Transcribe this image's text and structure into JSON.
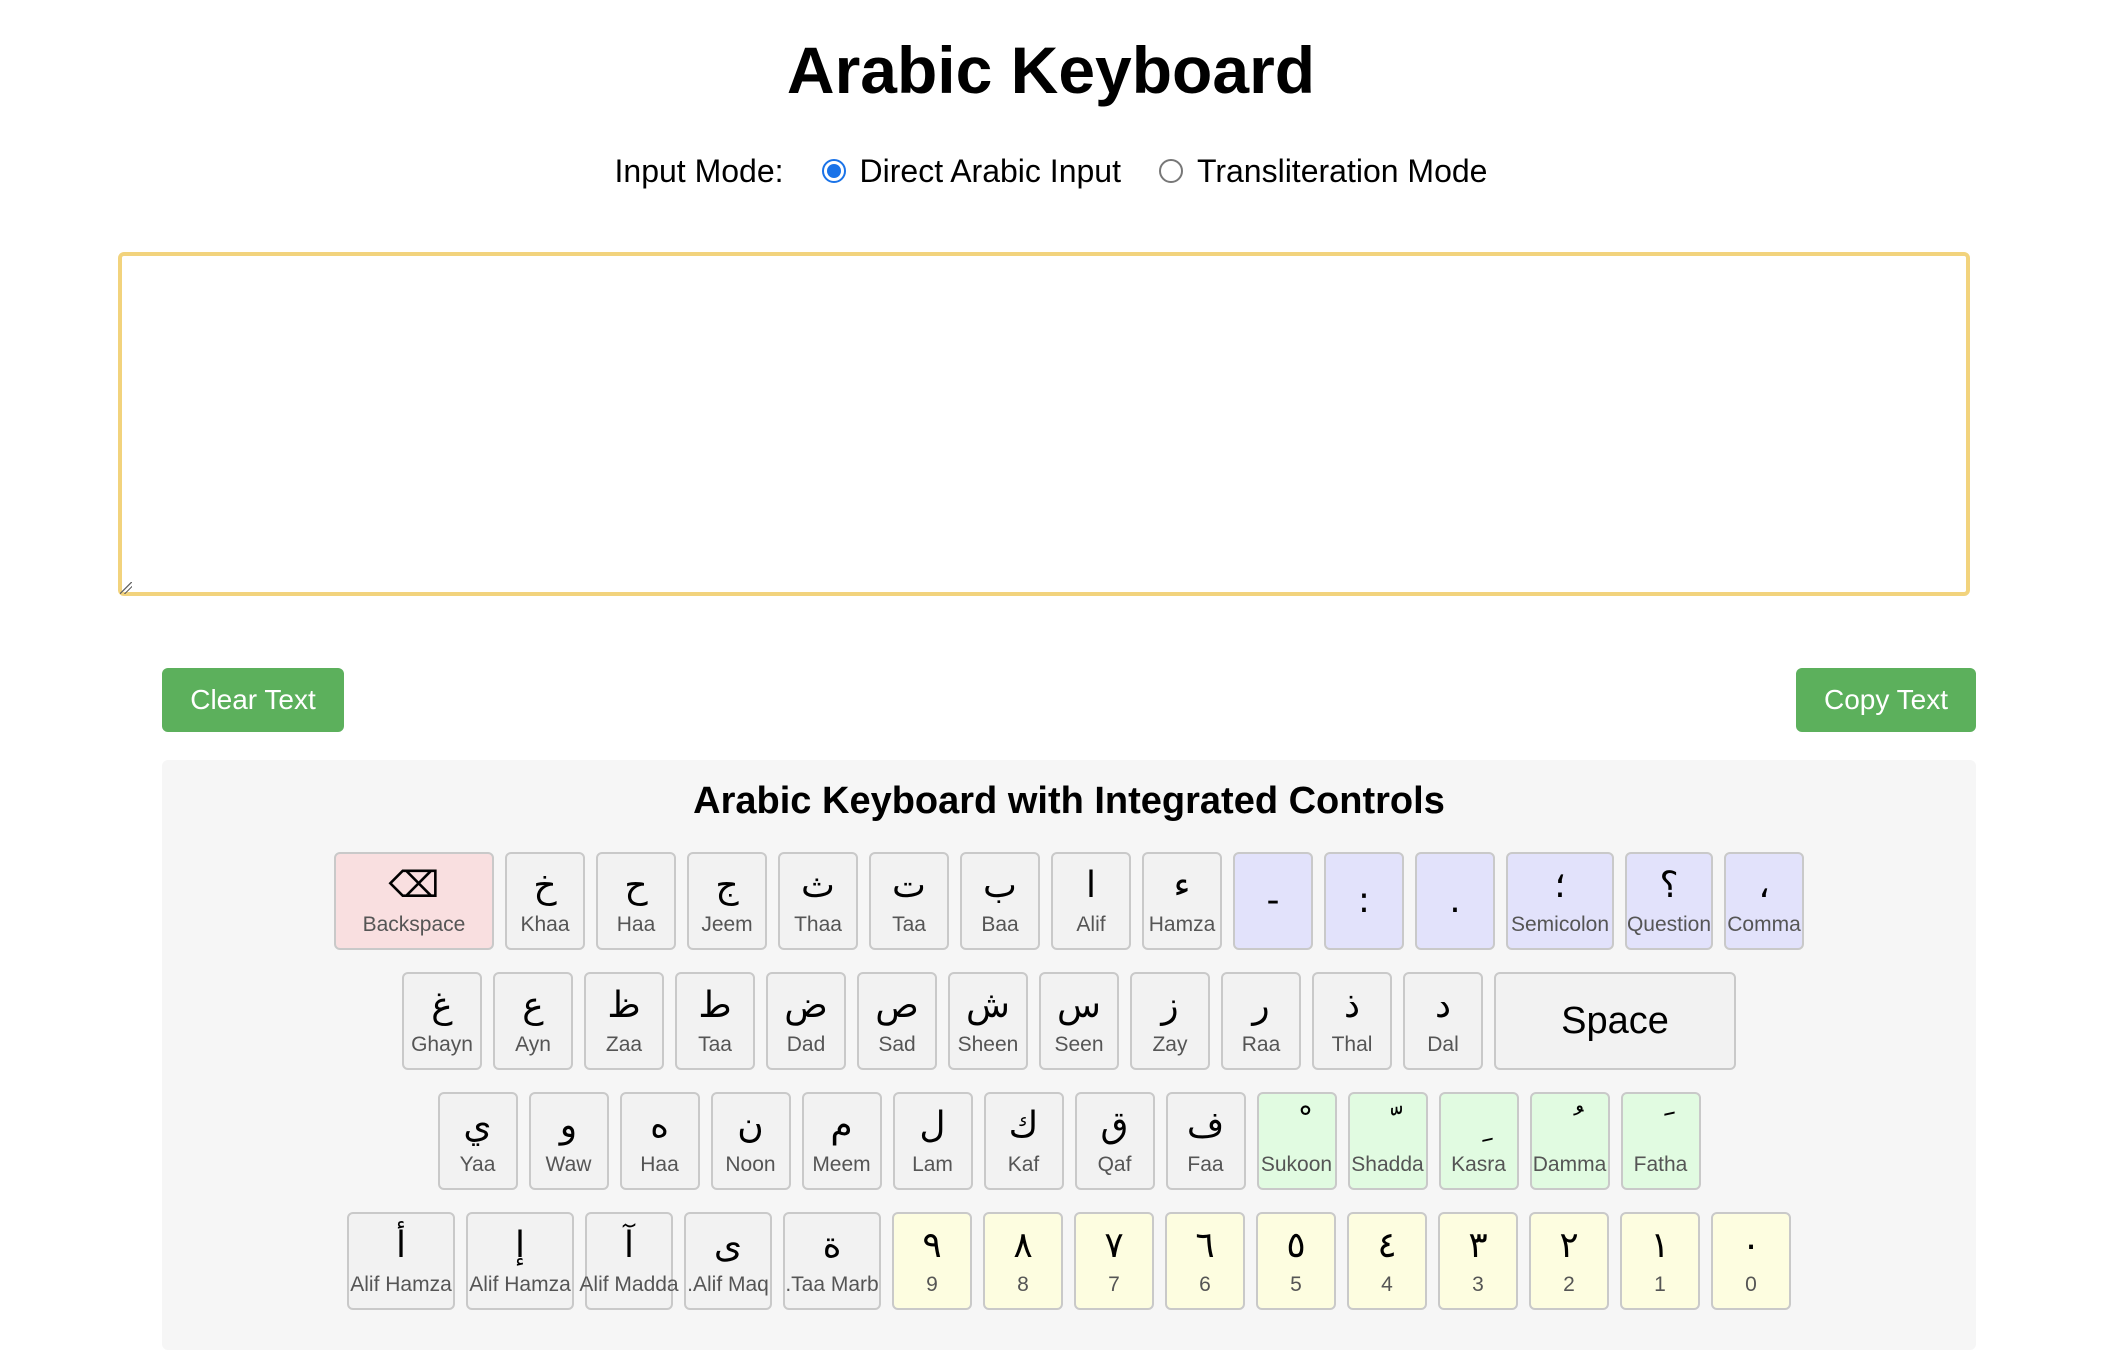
{
  "page": {
    "title": "Arabic Keyboard"
  },
  "input_mode": {
    "label": "Input Mode:",
    "options": [
      {
        "label": "Direct Arabic Input",
        "checked": true
      },
      {
        "label": "Transliteration Mode",
        "checked": false
      }
    ]
  },
  "textarea": {
    "value": ""
  },
  "buttons": {
    "clear": "Clear Text",
    "copy": "Copy Text"
  },
  "keyboard": {
    "title": "Arabic Keyboard with Integrated Controls",
    "rows": [
      [
        {
          "char": "⌫",
          "name": "Backspace",
          "kind": "ctrl",
          "icon": "backspace-icon"
        },
        {
          "char": "خ",
          "name": "Khaa"
        },
        {
          "char": "ح",
          "name": "Haa"
        },
        {
          "char": "ج",
          "name": "Jeem"
        },
        {
          "char": "ث",
          "name": "Thaa"
        },
        {
          "char": "ت",
          "name": "Taa"
        },
        {
          "char": "ب",
          "name": "Baa"
        },
        {
          "char": "ا",
          "name": "Alif"
        },
        {
          "char": "ء",
          "name": "Hamza"
        },
        {
          "char": "-",
          "name": "",
          "kind": "punct"
        },
        {
          "char": ":",
          "name": "",
          "kind": "punct"
        },
        {
          "char": ".",
          "name": "",
          "kind": "punct"
        },
        {
          "char": "؛",
          "name": "Semicolon",
          "kind": "punct"
        },
        {
          "char": "؟",
          "name": "Question",
          "kind": "punct"
        },
        {
          "char": "،",
          "name": "Comma",
          "kind": "punct"
        }
      ],
      [
        {
          "char": "غ",
          "name": "Ghayn"
        },
        {
          "char": "ع",
          "name": "Ayn"
        },
        {
          "char": "ظ",
          "name": "Zaa"
        },
        {
          "char": "ط",
          "name": "Taa"
        },
        {
          "char": "ض",
          "name": "Dad"
        },
        {
          "char": "ص",
          "name": "Sad"
        },
        {
          "char": "ش",
          "name": "Sheen"
        },
        {
          "char": "س",
          "name": "Seen"
        },
        {
          "char": "ز",
          "name": "Zay"
        },
        {
          "char": "ر",
          "name": "Raa"
        },
        {
          "char": "ذ",
          "name": "Thal"
        },
        {
          "char": "د",
          "name": "Dal"
        },
        {
          "char": "Space",
          "name": "",
          "kind": "space"
        }
      ],
      [
        {
          "char": "ي",
          "name": "Yaa"
        },
        {
          "char": "و",
          "name": "Waw"
        },
        {
          "char": "ه",
          "name": "Haa"
        },
        {
          "char": "ن",
          "name": "Noon"
        },
        {
          "char": "م",
          "name": "Meem"
        },
        {
          "char": "ل",
          "name": "Lam"
        },
        {
          "char": "ك",
          "name": "Kaf"
        },
        {
          "char": "ق",
          "name": "Qaf"
        },
        {
          "char": "ف",
          "name": "Faa"
        },
        {
          "char": "ْ",
          "name": "Sukoon",
          "kind": "diac"
        },
        {
          "char": "ّ",
          "name": "Shadda",
          "kind": "diac"
        },
        {
          "char": "ِ",
          "name": "Kasra",
          "kind": "diac"
        },
        {
          "char": "ُ",
          "name": "Damma",
          "kind": "diac"
        },
        {
          "char": "َ",
          "name": "Fatha",
          "kind": "diac"
        }
      ],
      [
        {
          "char": "أ",
          "name": "Alif Hamza"
        },
        {
          "char": "إ",
          "name": "Alif Hamza"
        },
        {
          "char": "آ",
          "name": "Alif Madda"
        },
        {
          "char": "ى",
          "name": ".Alif Maq"
        },
        {
          "char": "ة",
          "name": ".Taa Marb"
        },
        {
          "char": "٩",
          "name": "9",
          "kind": "num"
        },
        {
          "char": "٨",
          "name": "8",
          "kind": "num"
        },
        {
          "char": "٧",
          "name": "7",
          "kind": "num"
        },
        {
          "char": "٦",
          "name": "6",
          "kind": "num"
        },
        {
          "char": "٥",
          "name": "5",
          "kind": "num"
        },
        {
          "char": "٤",
          "name": "4",
          "kind": "num"
        },
        {
          "char": "٣",
          "name": "3",
          "kind": "num"
        },
        {
          "char": "٢",
          "name": "2",
          "kind": "num"
        },
        {
          "char": "١",
          "name": "1",
          "kind": "num"
        },
        {
          "char": "٠",
          "name": "0",
          "kind": "num"
        }
      ]
    ]
  }
}
